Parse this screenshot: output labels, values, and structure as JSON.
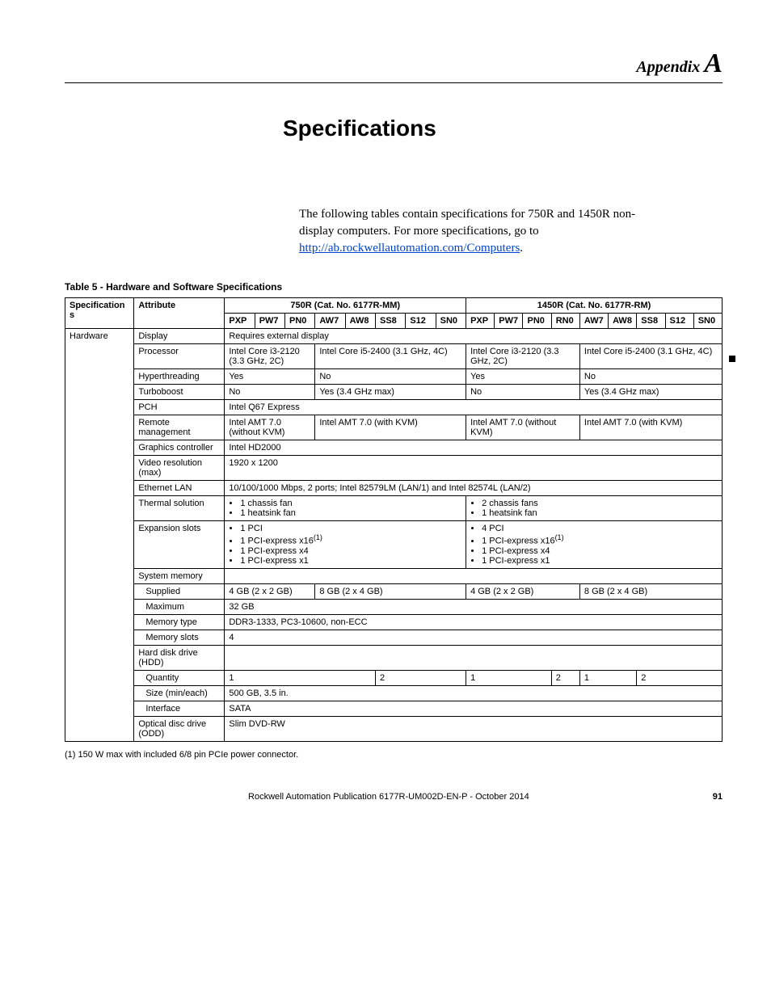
{
  "appendix_label": "Appendix",
  "appendix_letter": "A",
  "section_title": "Specifications",
  "intro": {
    "text_a": "The following tables contain specifications for 750R and 1450R non-display computers. For more specifications, go to ",
    "link_text": "http://ab.rockwellautomation.com/Computers",
    "link_href": "http://ab.rockwellautomation.com/Computers",
    "period": "."
  },
  "table_caption": "Table 5 - Hardware and Software Specifications",
  "group_headers": {
    "g750": "750R (Cat. No. 6177R-MM)",
    "g1450": "1450R (Cat. No. 6177R-RM)"
  },
  "col_labels": {
    "specs": "Specifications",
    "attr": "Attribute",
    "g750": [
      "PXP",
      "PW7",
      "PN0",
      "AW7",
      "AW8",
      "SS8",
      "S12",
      "SN0"
    ],
    "g1450": [
      "PXP",
      "PW7",
      "PN0",
      "RN0",
      "AW7",
      "AW8",
      "SS8",
      "S12",
      "SN0"
    ]
  },
  "rows": {
    "hardware_label": "Hardware",
    "display": {
      "attr": "Display",
      "val": "Requires external display"
    },
    "processor": {
      "attr": "Processor",
      "a": "Intel Core i3-2120 (3.3 GHz, 2C)",
      "b": "Intel Core i5-2400 (3.1 GHz, 4C)",
      "c": "Intel Core i3-2120 (3.3 GHz, 2C)",
      "d": "Intel Core i5-2400 (3.1 GHz, 4C)"
    },
    "hyperthreading": {
      "attr": "Hyperthreading",
      "a": "Yes",
      "b": "No",
      "c": "Yes",
      "d": "No"
    },
    "turboboost": {
      "attr": "Turboboost",
      "a": "No",
      "b": "Yes (3.4 GHz max)",
      "c": "No",
      "d": "Yes (3.4 GHz max)"
    },
    "pch": {
      "attr": "PCH",
      "val": "Intel Q67 Express"
    },
    "remote": {
      "attr": "Remote management",
      "a": "Intel AMT 7.0 (without KVM)",
      "b": "Intel AMT 7.0 (with KVM)",
      "c": "Intel AMT 7.0 (without KVM)",
      "d": "Intel AMT 7.0 (with KVM)"
    },
    "graphics": {
      "attr": "Graphics controller",
      "val": "Intel HD2000"
    },
    "videores": {
      "attr": "Video resolution (max)",
      "val": "1920 x 1200"
    },
    "ethernet": {
      "attr": "Ethernet LAN",
      "val": "10/100/1000 Mbps, 2 ports; Intel 82579LM (LAN/1) and Intel 82574L (LAN/2)"
    },
    "thermal": {
      "attr": "Thermal solution",
      "a_items": [
        "1 chassis fan",
        "1 heatsink fan"
      ],
      "b_items": [
        "2 chassis fans",
        "1 heatsink fan"
      ]
    },
    "expansion": {
      "attr": "Expansion slots",
      "a_items": [
        "1 PCI",
        "1 PCI-express x16",
        "1 PCI-express x4",
        "1 PCI-express x1"
      ],
      "b_items": [
        "4 PCI",
        "1 PCI-express x16",
        "1 PCI-express x4",
        "1 PCI-express x1"
      ],
      "sup": "(1)"
    },
    "sysmem": {
      "attr": "System memory"
    },
    "supplied": {
      "attr": "Supplied",
      "a": "4 GB (2 x 2 GB)",
      "b": "8 GB (2 x 4 GB)",
      "c": "4 GB (2 x 2 GB)",
      "d": "8 GB (2 x 4 GB)"
    },
    "maximum": {
      "attr": "Maximum",
      "val": "32 GB"
    },
    "memtype": {
      "attr": "Memory type",
      "val": "DDR3-1333, PC3-10600, non-ECC"
    },
    "memslots": {
      "attr": "Memory slots",
      "val": "4"
    },
    "hdd": {
      "attr": "Hard disk drive (HDD)"
    },
    "quantity": {
      "attr": "Quantity",
      "a": "1",
      "b": "2",
      "c": "1",
      "d": "2",
      "e": "1",
      "f": "2"
    },
    "size": {
      "attr": "Size (min/each)",
      "val": "500 GB, 3.5 in."
    },
    "interface": {
      "attr": "Interface",
      "val": "SATA"
    },
    "odd": {
      "attr": "Optical disc drive (ODD)",
      "val": "Slim DVD-RW"
    }
  },
  "footnote": "(1)  150 W max with included 6/8 pin PCIe power connector.",
  "footer": {
    "center": "Rockwell Automation Publication 6177R-UM002D-EN-P - October 2014",
    "page": "91"
  }
}
